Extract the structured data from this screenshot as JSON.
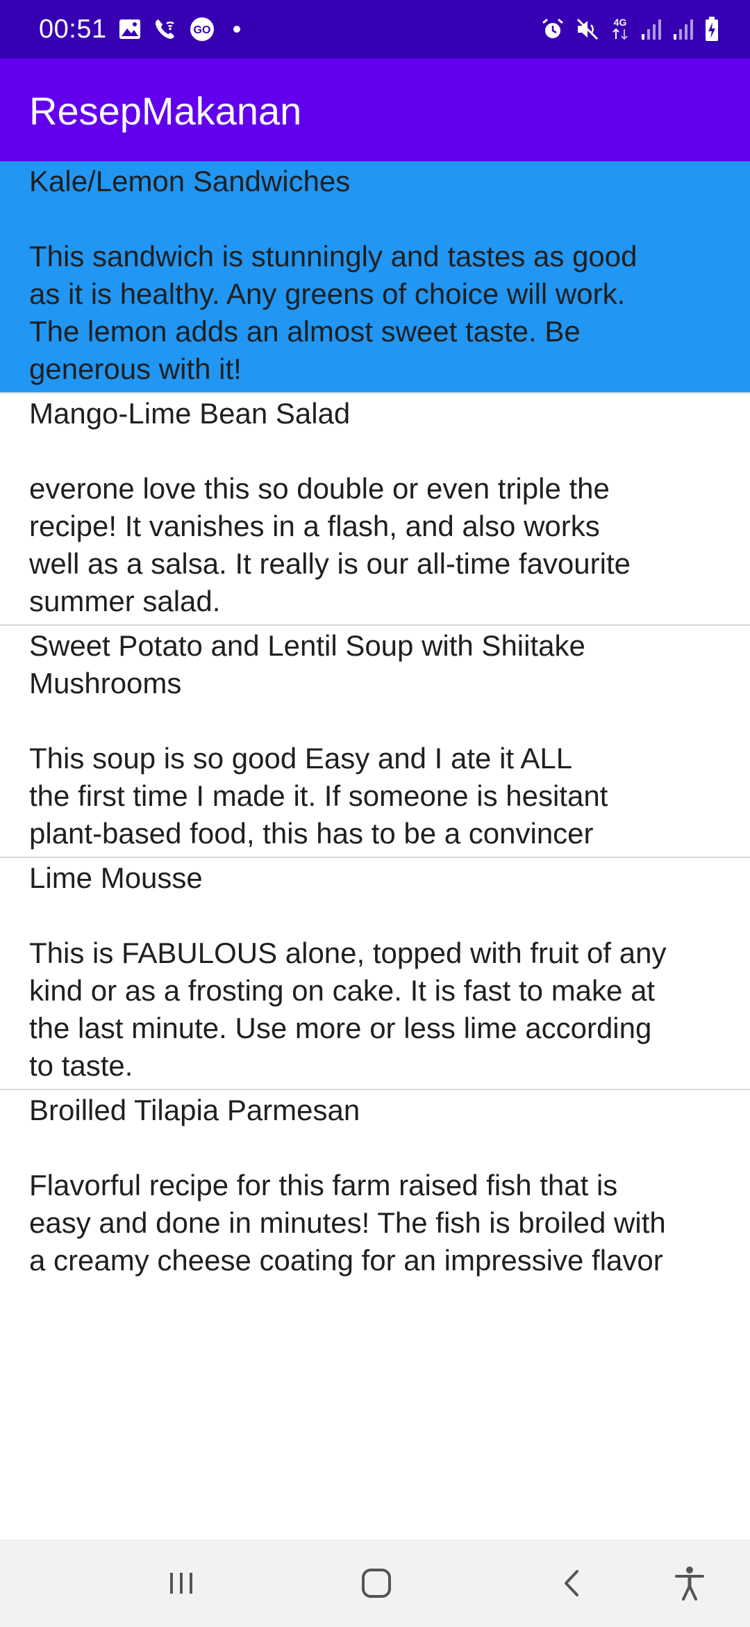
{
  "status_bar": {
    "time": "00:51",
    "left_icons": [
      "image-icon",
      "wifi-calling-icon",
      "go-icon",
      "dot-icon"
    ],
    "right_icons": [
      "alarm-icon",
      "mute-icon",
      "network-4g-icon",
      "signal-icon",
      "signal-icon",
      "battery-charging-icon"
    ],
    "network_label": "4G"
  },
  "app_bar": {
    "title": "ResepMakanan"
  },
  "recipes": [
    {
      "title": "Kale/Lemon Sandwiches",
      "description": "This sandwich is stunningly and tastes as good\nas it is healthy. Any greens of choice will work.\nThe lemon adds an almost sweet taste. Be\ngenerous with it!",
      "selected": true
    },
    {
      "title": "Mango-Lime Bean Salad",
      "description": "everone love this so double or even triple the\nrecipe! It vanishes in a flash, and also works\nwell as a salsa. It really is our all-time favourite\nsummer salad.",
      "selected": false
    },
    {
      "title": "Sweet Potato and Lentil Soup with Shiitake\nMushrooms",
      "description": "This soup is so good Easy and I ate it ALL\nthe first time I made it. If someone is hesitant\nplant-based food, this has to be a convincer",
      "selected": false
    },
    {
      "title": "Lime Mousse",
      "description": "This is FABULOUS alone, topped with fruit of any\nkind or as a frosting on cake. It is fast to make at\nthe last minute. Use more or less lime according\nto taste.",
      "selected": false
    },
    {
      "title": "Broilled Tilapia Parmesan",
      "description": "Flavorful recipe for this farm raised fish that is\neasy and done in minutes! The fish is broiled with\na creamy cheese coating for an impressive flavor",
      "selected": false
    }
  ],
  "nav_bar": {
    "buttons": [
      "recent-apps-icon",
      "home-icon",
      "back-icon",
      "accessibility-icon"
    ]
  },
  "colors": {
    "status_bar": "#3700b3",
    "app_bar": "#6200ee",
    "selected_item": "#2196f3",
    "nav_bar": "#f2f2f2"
  }
}
